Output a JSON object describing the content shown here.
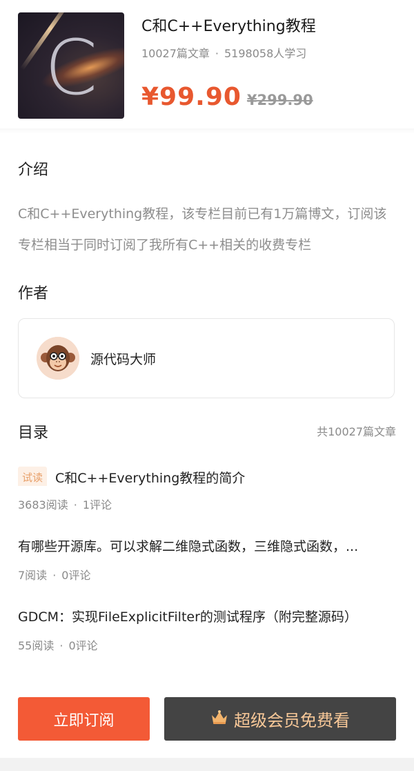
{
  "course": {
    "title": "C和C++Everything教程",
    "article_count": "10027篇文章",
    "separator": "·",
    "learners": "5198058人学习",
    "price": "¥99.90",
    "original_price": "¥299.90",
    "cover_letter": "C"
  },
  "intro": {
    "heading": "介绍",
    "text": "C和C++Everything教程，该专栏目前已有1万篇博文，订阅该专栏相当于同时订阅了我所有C++相关的收费专栏"
  },
  "author": {
    "heading": "作者",
    "name": "源代码大师",
    "avatar_icon": "monkey-avatar-icon"
  },
  "toc": {
    "heading": "目录",
    "count": "共10027篇文章",
    "items": [
      {
        "badge": "试读",
        "title": "C和C++Everything教程的简介",
        "reads": "3683阅读",
        "separator": "·",
        "comments": "1评论"
      },
      {
        "badge": "",
        "title": "有哪些开源库。可以求解二维隐式函数，三维隐式函数，...",
        "reads": "7阅读",
        "separator": "·",
        "comments": "0评论"
      },
      {
        "badge": "",
        "title": "GDCM：实现FileExplicitFilter的测试程序（附完整源码）",
        "reads": "55阅读",
        "separator": "·",
        "comments": "0评论"
      }
    ]
  },
  "actions": {
    "subscribe_label": "立即订阅",
    "vip_label": "超级会员免费看",
    "vip_icon": "crown-icon"
  },
  "colors": {
    "accent": "#f35a36",
    "price": "#e8582f",
    "vip_bg": "#444444",
    "vip_text": "#f8c898"
  }
}
